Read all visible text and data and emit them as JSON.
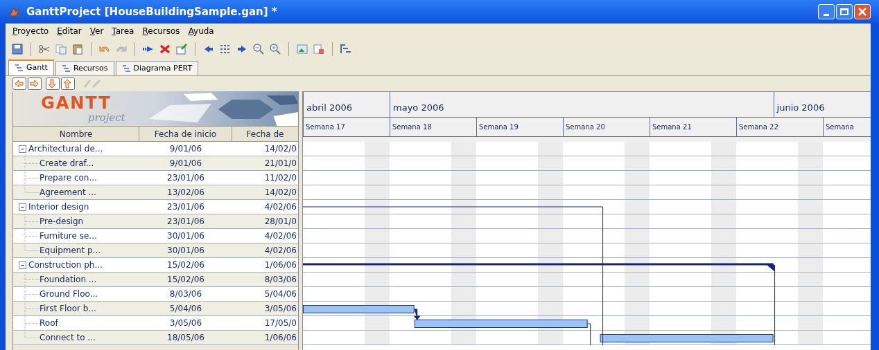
{
  "window": {
    "title": "GanttProject [HouseBuildingSample.gan] *"
  },
  "menu": [
    "Proyecto",
    "Editar",
    "Ver",
    "Tarea",
    "Recursos",
    "Ayuda"
  ],
  "tabs": [
    {
      "label": "Gantt",
      "selected": true
    },
    {
      "label": "Recursos",
      "selected": false
    },
    {
      "label": "Diagrama PERT",
      "selected": false
    }
  ],
  "logo": {
    "title": "GANTT",
    "subtitle": "project"
  },
  "table": {
    "columns": [
      "Nombre",
      "Fecha de inicio",
      "Fecha de"
    ],
    "rows": [
      {
        "name": "Architectural de...",
        "start": "9/01/06",
        "end": "14/02/0",
        "expanded": true,
        "children": [
          {
            "name": "Create draf...",
            "start": "9/01/06",
            "end": "21/01/0"
          },
          {
            "name": "Prepare con...",
            "start": "23/01/06",
            "end": "11/02/0"
          },
          {
            "name": "Agreement ...",
            "start": "13/02/06",
            "end": "14/02/0"
          }
        ]
      },
      {
        "name": "Interior design",
        "start": "23/01/06",
        "end": "4/02/06",
        "expanded": true,
        "children": [
          {
            "name": "Pre-design",
            "start": "23/01/06",
            "end": "28/01/0"
          },
          {
            "name": "Furniture se...",
            "start": "30/01/06",
            "end": "4/02/06"
          },
          {
            "name": "Equipment p...",
            "start": "30/01/06",
            "end": "4/02/06"
          }
        ]
      },
      {
        "name": "Construction ph...",
        "start": "15/02/06",
        "end": "1/06/06",
        "expanded": true,
        "children": [
          {
            "name": "Foundation ...",
            "start": "15/02/06",
            "end": "8/03/06"
          },
          {
            "name": "Ground Floo...",
            "start": "8/03/06",
            "end": "5/04/06"
          },
          {
            "name": "First Floor b...",
            "start": "5/04/06",
            "end": "3/05/06"
          },
          {
            "name": "Roof",
            "start": "3/05/06",
            "end": "17/05/0"
          },
          {
            "name": "Connect to ...",
            "start": "18/05/06",
            "end": "1/06/06"
          }
        ]
      }
    ]
  },
  "timeline": {
    "months": [
      "abril 2006",
      "mayo 2006",
      "junio 2006"
    ],
    "weeks": [
      "Semana 17",
      "Semana 18",
      "Semana 19",
      "Semana 20",
      "Semana 21",
      "Semana 22",
      "Semana"
    ]
  }
}
